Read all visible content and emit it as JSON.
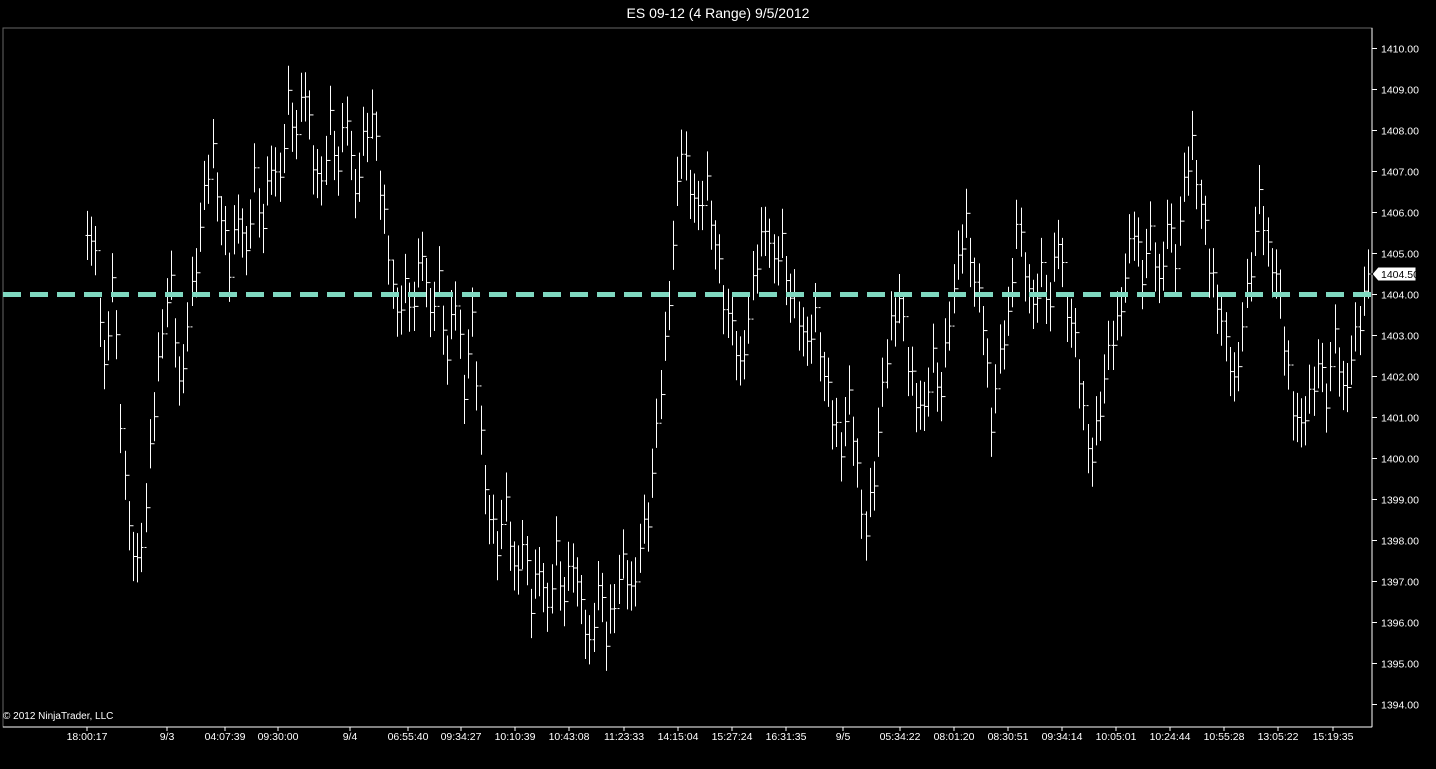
{
  "window": {
    "title": "ES 09-12 (4 Range)  9/5/2012",
    "copyright": "© 2012 NinjaTrader, LLC"
  },
  "colors": {
    "background": "#000000",
    "bar": "#ffffff",
    "reference_line": "#7fd8c0",
    "axis": "#ffffff"
  },
  "chart_data": {
    "type": "range bars (HLC)",
    "instrument": "ES 09-12",
    "bar_type": "4 Range",
    "date": "9/5/2012",
    "ylim": [
      1394,
      1410
    ],
    "y_ticks": [
      "1394.00",
      "1395.00",
      "1396.00",
      "1397.00",
      "1398.00",
      "1399.00",
      "1400.00",
      "1401.00",
      "1402.00",
      "1403.00",
      "1404.00",
      "1405.00",
      "1406.00",
      "1407.00",
      "1408.00",
      "1409.00",
      "1410.00"
    ],
    "x_labels": [
      "18:00:17",
      "9/3",
      "04:07:39",
      "09:30:00",
      "9/4",
      "06:55:40",
      "09:34:27",
      "10:10:39",
      "10:43:08",
      "11:23:33",
      "14:15:04",
      "15:27:24",
      "16:31:35",
      "9/5",
      "05:34:22",
      "08:01:20",
      "08:30:51",
      "09:34:14",
      "10:05:01",
      "10:24:44",
      "10:55:28",
      "13:05:22",
      "15:19:35"
    ],
    "last_price": "1404.50",
    "reference_level": 1404.0,
    "bar_range": 1.0,
    "close_path": [
      1405.8,
      1404.8,
      1402.2,
      1404.5,
      1401.0,
      1398.0,
      1397.4,
      1398.8,
      1401.2,
      1403.4,
      1404.2,
      1401.8,
      1403.3,
      1404.8,
      1406.3,
      1407.5,
      1405.8,
      1404.6,
      1406.2,
      1404.8,
      1407.0,
      1405.7,
      1407.3,
      1406.5,
      1408.8,
      1407.9,
      1409.0,
      1407.4,
      1406.5,
      1408.4,
      1407.1,
      1408.5,
      1406.1,
      1407.8,
      1408.4,
      1406.6,
      1405.2,
      1403.3,
      1404.3,
      1403.8,
      1405.2,
      1403.2,
      1404.4,
      1402.4,
      1403.9,
      1401.8,
      1403.3,
      1400.6,
      1398.6,
      1397.9,
      1398.7,
      1397.2,
      1397.9,
      1396.4,
      1397.6,
      1396.1,
      1397.9,
      1396.6,
      1397.6,
      1396.2,
      1395.4,
      1396.9,
      1395.6,
      1396.7,
      1397.4,
      1396.8,
      1397.9,
      1398.6,
      1400.5,
      1402.8,
      1405.2,
      1407.6,
      1406.8,
      1405.9,
      1406.8,
      1405.3,
      1403.9,
      1403.0,
      1402.2,
      1403.4,
      1404.8,
      1405.9,
      1404.6,
      1405.4,
      1404.0,
      1403.5,
      1402.5,
      1403.5,
      1402.0,
      1401.0,
      1400.4,
      1401.4,
      1399.8,
      1398.2,
      1399.6,
      1401.5,
      1403.3,
      1403.9,
      1402.3,
      1401.6,
      1401.0,
      1402.6,
      1401.6,
      1403.5,
      1404.6,
      1405.8,
      1404.3,
      1403.3,
      1401.0,
      1402.4,
      1403.5,
      1405.8,
      1404.7,
      1403.4,
      1404.6,
      1403.7,
      1405.4,
      1403.8,
      1402.8,
      1401.2,
      1400.0,
      1401.3,
      1402.4,
      1403.3,
      1404.4,
      1405.6,
      1404.6,
      1405.4,
      1404.3,
      1405.8,
      1404.9,
      1406.5,
      1407.7,
      1406.2,
      1404.7,
      1404.0,
      1402.7,
      1401.9,
      1403.3,
      1404.7,
      1406.2,
      1405.1,
      1404.5,
      1402.8,
      1401.4,
      1400.6,
      1401.6,
      1402.4,
      1401.5,
      1402.8,
      1401.6,
      1402.4,
      1403.3,
      1404.5
    ]
  }
}
